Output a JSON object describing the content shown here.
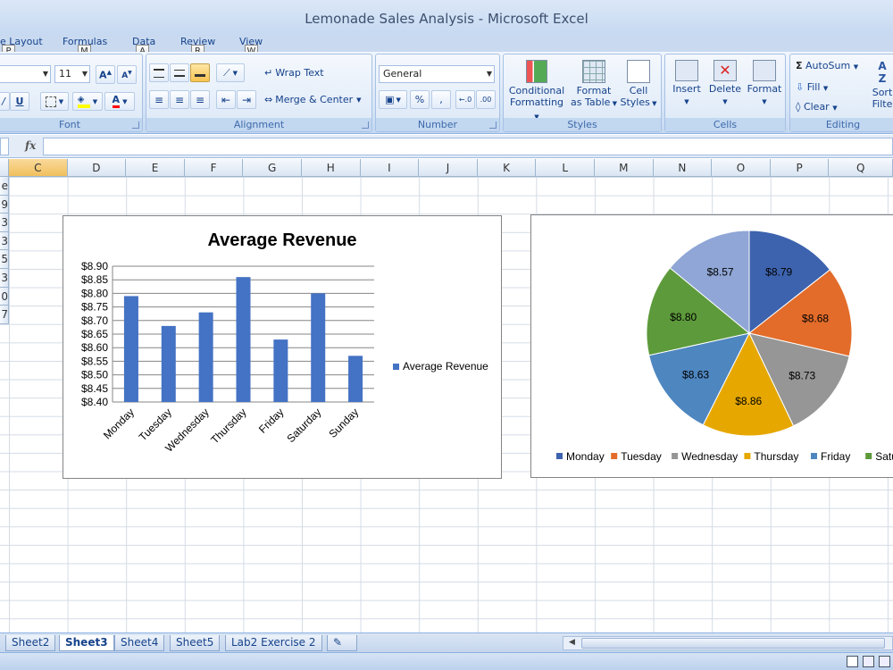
{
  "window": {
    "title": "Lemonade Sales Analysis - Microsoft Excel"
  },
  "ribbon_tabs": [
    {
      "label": "e Layout",
      "keytip": "P"
    },
    {
      "label": "Formulas",
      "keytip": "M"
    },
    {
      "label": "Data",
      "keytip": "A"
    },
    {
      "label": "Review",
      "keytip": "R"
    },
    {
      "label": "View",
      "keytip": "W"
    }
  ],
  "font_group": {
    "label": "Font",
    "size": "11",
    "bold_label": "U"
  },
  "alignment_group": {
    "label": "Alignment",
    "wrap_text": "Wrap Text",
    "merge_center": "Merge & Center"
  },
  "number_group": {
    "label": "Number",
    "format": "General",
    "percent": "%",
    "comma": ",",
    "inc_decimal": ".00",
    "dec_decimal": ".00"
  },
  "styles_group": {
    "label": "Styles",
    "conditional": "Conditional",
    "conditional2": "Formatting",
    "format_table": "Format",
    "format_table2": "as Table",
    "cell_styles": "Cell",
    "cell_styles2": "Styles"
  },
  "cells_group": {
    "label": "Cells",
    "insert": "Insert",
    "delete": "Delete",
    "format": "Format"
  },
  "editing_group": {
    "label": "Editing",
    "autosum": "AutoSum",
    "fill": "Fill",
    "clear": "Clear",
    "sort": "Sort",
    "filter": "Filte"
  },
  "formula_bar": {
    "fx": "fx",
    "value": ""
  },
  "columns": [
    "C",
    "D",
    "E",
    "F",
    "G",
    "H",
    "I",
    "J",
    "K",
    "L",
    "M",
    "N",
    "O",
    "P",
    "Q"
  ],
  "row_fragments": [
    "e",
    "9",
    "3",
    "3",
    "5",
    "3",
    "0",
    "7"
  ],
  "sheets": [
    "Sheet2",
    "Sheet3",
    "Sheet4",
    "Sheet5",
    "Lab2 Exercise 2"
  ],
  "active_sheet": "Sheet3",
  "chart_data": [
    {
      "type": "bar",
      "title": "Average Revenue",
      "categories": [
        "Monday",
        "Tuesday",
        "Wednesday",
        "Thursday",
        "Friday",
        "Saturday",
        "Sunday"
      ],
      "series": [
        {
          "name": "Average Revenue",
          "values": [
            8.79,
            8.68,
            8.73,
            8.86,
            8.63,
            8.8,
            8.57
          ],
          "color": "#4472c4"
        }
      ],
      "ylim": [
        8.4,
        8.9
      ],
      "yticks": [
        "$8.40",
        "$8.45",
        "$8.50",
        "$8.55",
        "$8.60",
        "$8.65",
        "$8.70",
        "$8.75",
        "$8.80",
        "$8.85",
        "$8.90"
      ],
      "legend": "right",
      "grid": true
    },
    {
      "type": "pie",
      "categories": [
        "Monday",
        "Tuesday",
        "Wednesday",
        "Thursday",
        "Friday",
        "Saturday",
        "Sunday"
      ],
      "values": [
        8.79,
        8.68,
        8.73,
        8.86,
        8.63,
        8.8,
        8.57
      ],
      "labels": [
        "$8.79",
        "$8.68",
        "$8.73",
        "$8.86",
        "$8.63",
        "$8.80",
        "$8.57"
      ],
      "colors": [
        "#3d63ae",
        "#e36c2a",
        "#969696",
        "#e6a800",
        "#4e86c0",
        "#5d9a3b",
        "#8fa6d6"
      ],
      "legend_entries": [
        "Monday",
        "Tuesday",
        "Wednesday",
        "Thursday",
        "Friday",
        "Saturday"
      ],
      "legend": "bottom"
    }
  ]
}
